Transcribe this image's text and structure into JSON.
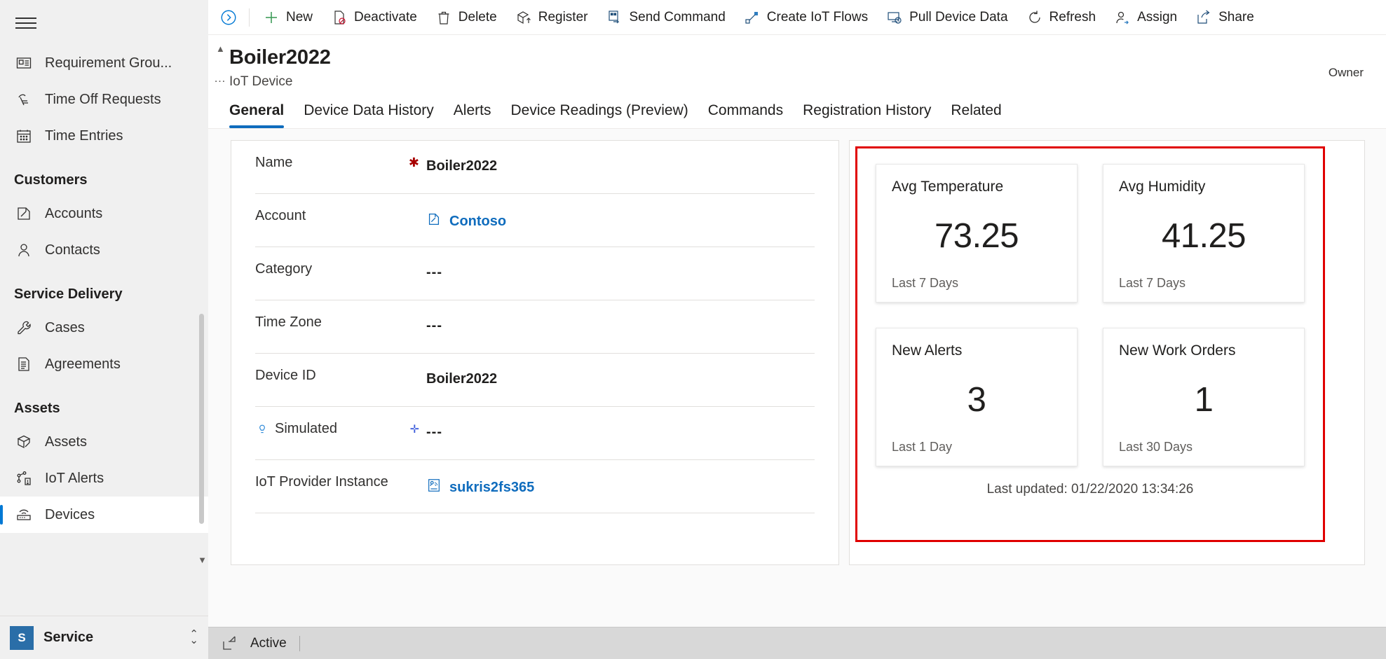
{
  "sidebar": {
    "menu_icon": "hamburger-icon",
    "items": [
      {
        "label": "Requirement Grou...",
        "icon": "requirement-group-icon",
        "selected": false
      },
      {
        "label": "Time Off Requests",
        "icon": "time-off-icon",
        "selected": false
      },
      {
        "label": "Time Entries",
        "icon": "calendar-icon",
        "selected": false
      }
    ],
    "groups": [
      {
        "title": "Customers",
        "items": [
          {
            "label": "Accounts",
            "icon": "account-icon",
            "selected": false
          },
          {
            "label": "Contacts",
            "icon": "contact-person-icon",
            "selected": false
          }
        ]
      },
      {
        "title": "Service Delivery",
        "items": [
          {
            "label": "Cases",
            "icon": "wrench-icon",
            "selected": false
          },
          {
            "label": "Agreements",
            "icon": "document-list-icon",
            "selected": false
          }
        ]
      },
      {
        "title": "Assets",
        "items": [
          {
            "label": "Assets",
            "icon": "box-tag-icon",
            "selected": false
          },
          {
            "label": "IoT Alerts",
            "icon": "iot-alerts-icon",
            "selected": false
          },
          {
            "label": "Devices",
            "icon": "device-router-icon",
            "selected": true
          }
        ]
      }
    ],
    "footer": {
      "badge": "S",
      "label": "Service",
      "chevron_icon": "chevron-updown-icon"
    }
  },
  "commandbar": {
    "expand_icon": "chevron-right-circle-icon",
    "buttons": [
      {
        "label": "New",
        "icon": "plus-icon"
      },
      {
        "label": "Deactivate",
        "icon": "deactivate-icon"
      },
      {
        "label": "Delete",
        "icon": "trash-icon"
      },
      {
        "label": "Register",
        "icon": "register-box-icon"
      },
      {
        "label": "Send Command",
        "icon": "send-command-icon"
      },
      {
        "label": "Create IoT Flows",
        "icon": "flow-icon"
      },
      {
        "label": "Pull Device Data",
        "icon": "pull-data-icon"
      },
      {
        "label": "Refresh",
        "icon": "refresh-icon"
      },
      {
        "label": "Assign",
        "icon": "assign-person-icon"
      },
      {
        "label": "Share",
        "icon": "share-icon"
      }
    ]
  },
  "record": {
    "title": "Boiler2022",
    "subtitle": "IoT Device",
    "owner_label": "Owner"
  },
  "tabs": [
    {
      "label": "General",
      "active": true
    },
    {
      "label": "Device Data History",
      "active": false
    },
    {
      "label": "Alerts",
      "active": false
    },
    {
      "label": "Device Readings (Preview)",
      "active": false
    },
    {
      "label": "Commands",
      "active": false
    },
    {
      "label": "Registration History",
      "active": false
    },
    {
      "label": "Related",
      "active": false
    }
  ],
  "form": {
    "fields": [
      {
        "label": "Name",
        "value": "Boiler2022",
        "required": true,
        "optional": false,
        "type": "text",
        "icon": ""
      },
      {
        "label": "Account",
        "value": "Contoso",
        "required": false,
        "optional": false,
        "type": "link",
        "icon": "account-lookup-icon"
      },
      {
        "label": "Category",
        "value": "---",
        "required": false,
        "optional": false,
        "type": "empty",
        "icon": ""
      },
      {
        "label": "Time Zone",
        "value": "---",
        "required": false,
        "optional": false,
        "type": "empty",
        "icon": ""
      },
      {
        "label": "Device ID",
        "value": "Boiler2022",
        "required": false,
        "optional": false,
        "type": "text",
        "icon": ""
      },
      {
        "label": "Simulated",
        "value": "---",
        "required": false,
        "optional": true,
        "type": "empty",
        "icon": "bulb-icon"
      },
      {
        "label": "IoT Provider Instance",
        "value": "sukris2fs365",
        "required": false,
        "optional": false,
        "type": "link",
        "icon": "iot-provider-icon"
      }
    ]
  },
  "kpi_panel": {
    "highlight_color": "#e00000",
    "cards": [
      {
        "title": "Avg Temperature",
        "value": "73.25",
        "period": "Last 7 Days"
      },
      {
        "title": "Avg Humidity",
        "value": "41.25",
        "period": "Last 7 Days"
      },
      {
        "title": "New Alerts",
        "value": "3",
        "period": "Last 1 Day"
      },
      {
        "title": "New Work Orders",
        "value": "1",
        "period": "Last 30 Days"
      }
    ],
    "last_updated": "Last updated: 01/22/2020 13:34:26"
  },
  "statusbar": {
    "icon": "open-record-icon",
    "status": "Active"
  }
}
